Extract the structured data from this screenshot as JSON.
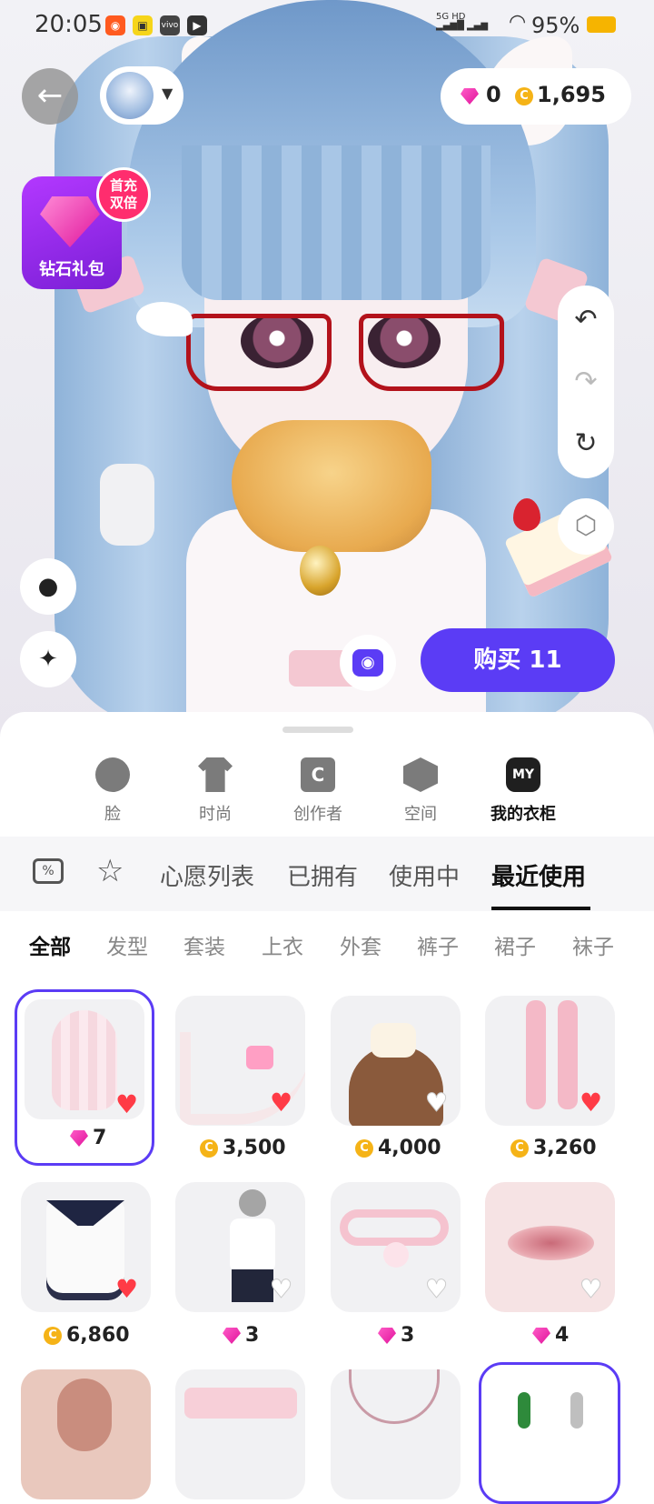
{
  "status_bar": {
    "time": "20:05",
    "network": "5G HD",
    "battery_pct": "95%"
  },
  "top_bar": {
    "back_icon": "arrow-left-icon",
    "gems": "0",
    "coins": "1,695"
  },
  "promo": {
    "label": "钻石礼包",
    "badge_line1": "首充",
    "badge_line2": "双倍"
  },
  "actions": {
    "buy_label": "购买 11",
    "accent_color": "#5b3cf5"
  },
  "categories": [
    {
      "label": "脸",
      "icon": "face-icon"
    },
    {
      "label": "时尚",
      "icon": "tshirt-icon"
    },
    {
      "label": "创作者",
      "icon": "creator-bag-icon"
    },
    {
      "label": "空间",
      "icon": "cube-icon"
    },
    {
      "label": "我的衣柜",
      "icon": "my-wardrobe-icon",
      "icon_text": "MY",
      "active": true
    }
  ],
  "subtabs": [
    "心愿列表",
    "已拥有",
    "使用中",
    "最近使用"
  ],
  "filters": [
    "全部",
    "发型",
    "套装",
    "上衣",
    "外套",
    "裤子",
    "裙子",
    "袜子"
  ],
  "items": [
    {
      "currency": "gem",
      "price": "7",
      "liked": true,
      "selected": true,
      "icon": "pink-twintail-hair"
    },
    {
      "currency": "coin",
      "price": "3,500",
      "liked": true,
      "icon": "cat-tail-bell"
    },
    {
      "currency": "coin",
      "price": "4,000",
      "liked": false,
      "icon": "kitty-hat-bob"
    },
    {
      "currency": "coin",
      "price": "3,260",
      "liked": true,
      "icon": "pink-leg-warmers"
    },
    {
      "currency": "coin",
      "price": "6,860",
      "liked": true,
      "icon": "sailor-dress"
    },
    {
      "currency": "gem",
      "price": "3",
      "liked": false,
      "icon": "pose-figure"
    },
    {
      "currency": "gem",
      "price": "3",
      "liked": false,
      "icon": "pink-bell-collar"
    },
    {
      "currency": "gem",
      "price": "4",
      "liked": false,
      "icon": "lips"
    }
  ]
}
